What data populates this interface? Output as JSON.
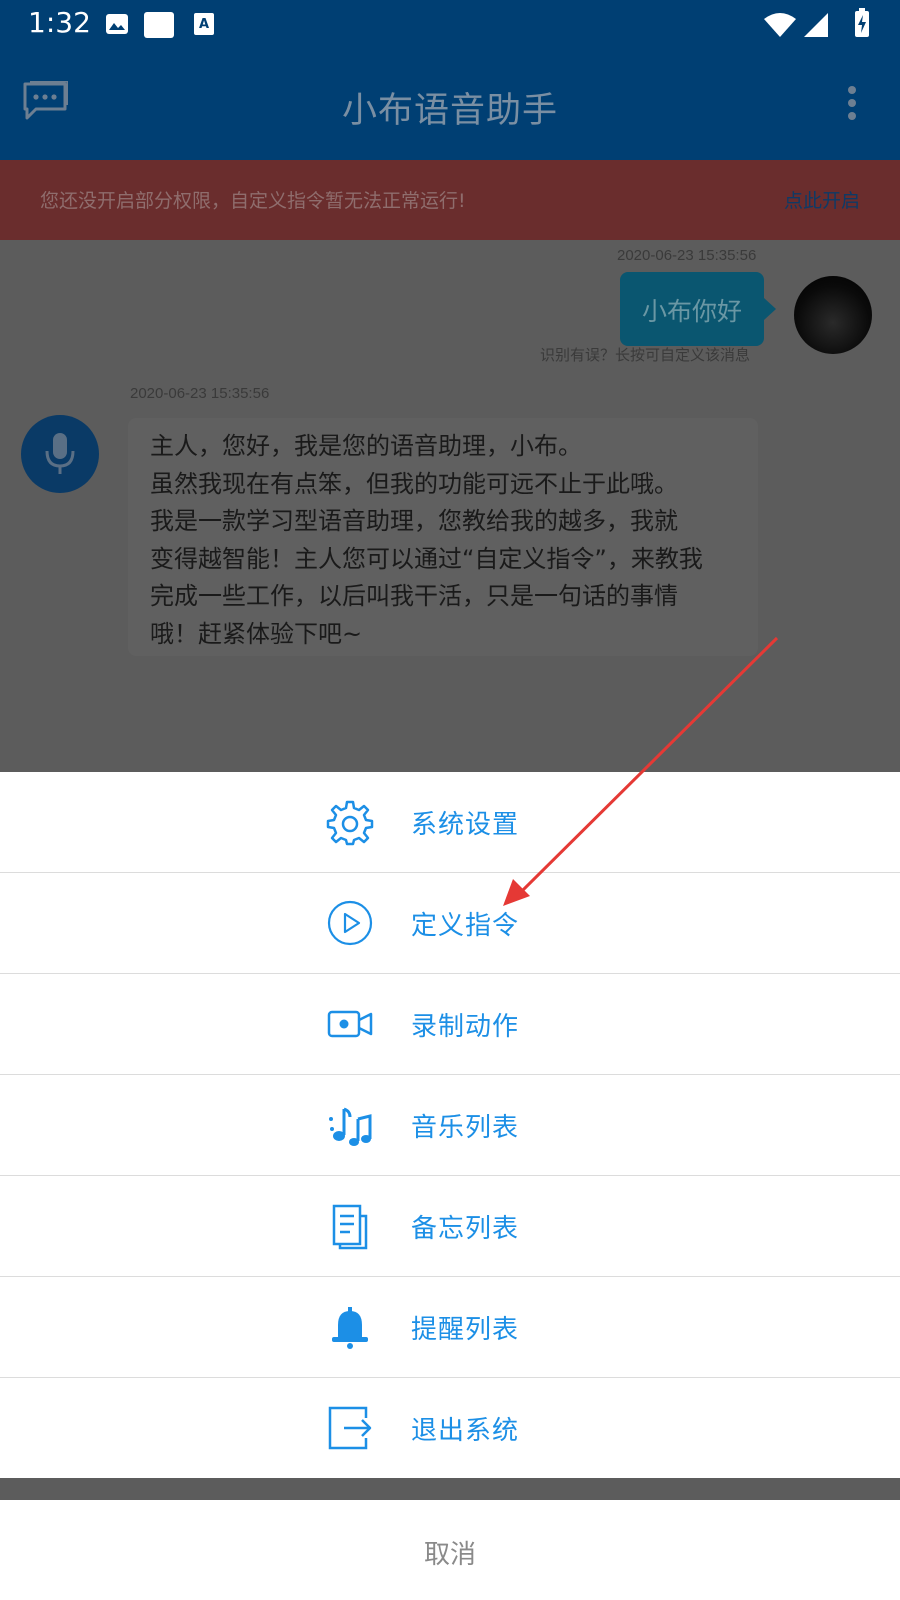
{
  "status_bar": {
    "time": "1:32"
  },
  "app_bar": {
    "title": "小布语音助手"
  },
  "banner": {
    "message": "您还没开启部分权限，自定义指令暂无法正常运行!",
    "action": "点此开启"
  },
  "chat": {
    "user_message": {
      "timestamp": "2020-06-23 15:35:56",
      "text": "小布你好",
      "hint": "识别有误？长按可自定义该消息"
    },
    "bot_message": {
      "timestamp": "2020-06-23 15:35:56",
      "text": "主人，您好，我是您的语音助理，小布。\n虽然我现在有点笨，但我的功能可远不止于此哦。\n我是一款学习型语音助理，您教给我的越多，我就\n变得越智能！主人您可以通过“自定义指令”，来教我\n完成一些工作，以后叫我干活，只是一句话的事情\n哦！赶紧体验下吧~"
    }
  },
  "menu": {
    "items": [
      {
        "label": "系统设置",
        "icon": "gear-icon"
      },
      {
        "label": "定义指令",
        "icon": "play-circle-icon"
      },
      {
        "label": "录制动作",
        "icon": "video-camera-icon"
      },
      {
        "label": "音乐列表",
        "icon": "music-note-icon"
      },
      {
        "label": "备忘列表",
        "icon": "memo-icon"
      },
      {
        "label": "提醒列表",
        "icon": "bell-icon"
      },
      {
        "label": "退出系统",
        "icon": "exit-icon"
      }
    ],
    "cancel": "取消"
  },
  "colors": {
    "app_bar": "#003f73",
    "accent": "#1c8fe6",
    "arrow": "#e53935"
  }
}
